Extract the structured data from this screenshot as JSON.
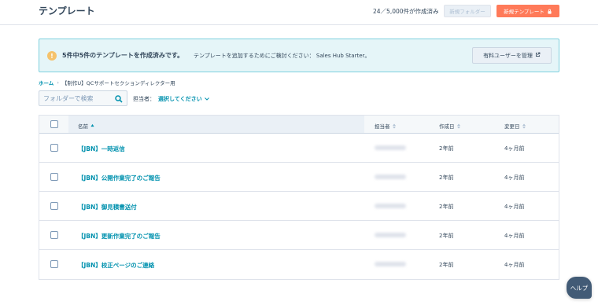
{
  "header": {
    "title": "テンプレート",
    "count_text": "24／5,000件が作成済み",
    "new_folder_label": "新規フォルダー",
    "new_template_label": "新規テンプレート"
  },
  "banner": {
    "strong_text": "5件中5件のテンプレートを作成済みです。",
    "text": "テンプレートを追加するためにご検討ください：  Sales Hub Starter。",
    "manage_label": "有料ユーザーを管理"
  },
  "breadcrumb": {
    "home": "ホーム",
    "separator": "›",
    "current": "【制作U】QCサポートセクションディレクター用"
  },
  "search": {
    "placeholder": "フォルダーで検索"
  },
  "owner_filter": {
    "label": "担当者：",
    "value": "選択してください"
  },
  "table": {
    "columns": [
      "名前",
      "担当者",
      "作成日",
      "変更日"
    ],
    "rows": [
      {
        "name": "【JBN】一時返信",
        "created": "2年前",
        "modified": "4ヶ月前"
      },
      {
        "name": "【JBN】公開作業完了のご報告",
        "created": "2年前",
        "modified": "4ヶ月前"
      },
      {
        "name": "【JBN】御見積書送付",
        "created": "2年前",
        "modified": "4ヶ月前"
      },
      {
        "name": "【JBN】更新作業完了のご報告",
        "created": "2年前",
        "modified": "4ヶ月前"
      },
      {
        "name": "【JBN】校正ページのご連絡",
        "created": "2年前",
        "modified": "4ヶ月前"
      }
    ]
  },
  "help": {
    "label": "ヘルプ"
  },
  "colors": {
    "accent": "#ff7a59",
    "link": "#0091ae",
    "banner_bg": "#e5f5f8",
    "text": "#33475b",
    "help_bg": "#425b76"
  },
  "icons": [
    "warning-icon",
    "external-link-icon",
    "lock-icon",
    "search-icon",
    "chevron-down-icon",
    "sort-icon"
  ]
}
